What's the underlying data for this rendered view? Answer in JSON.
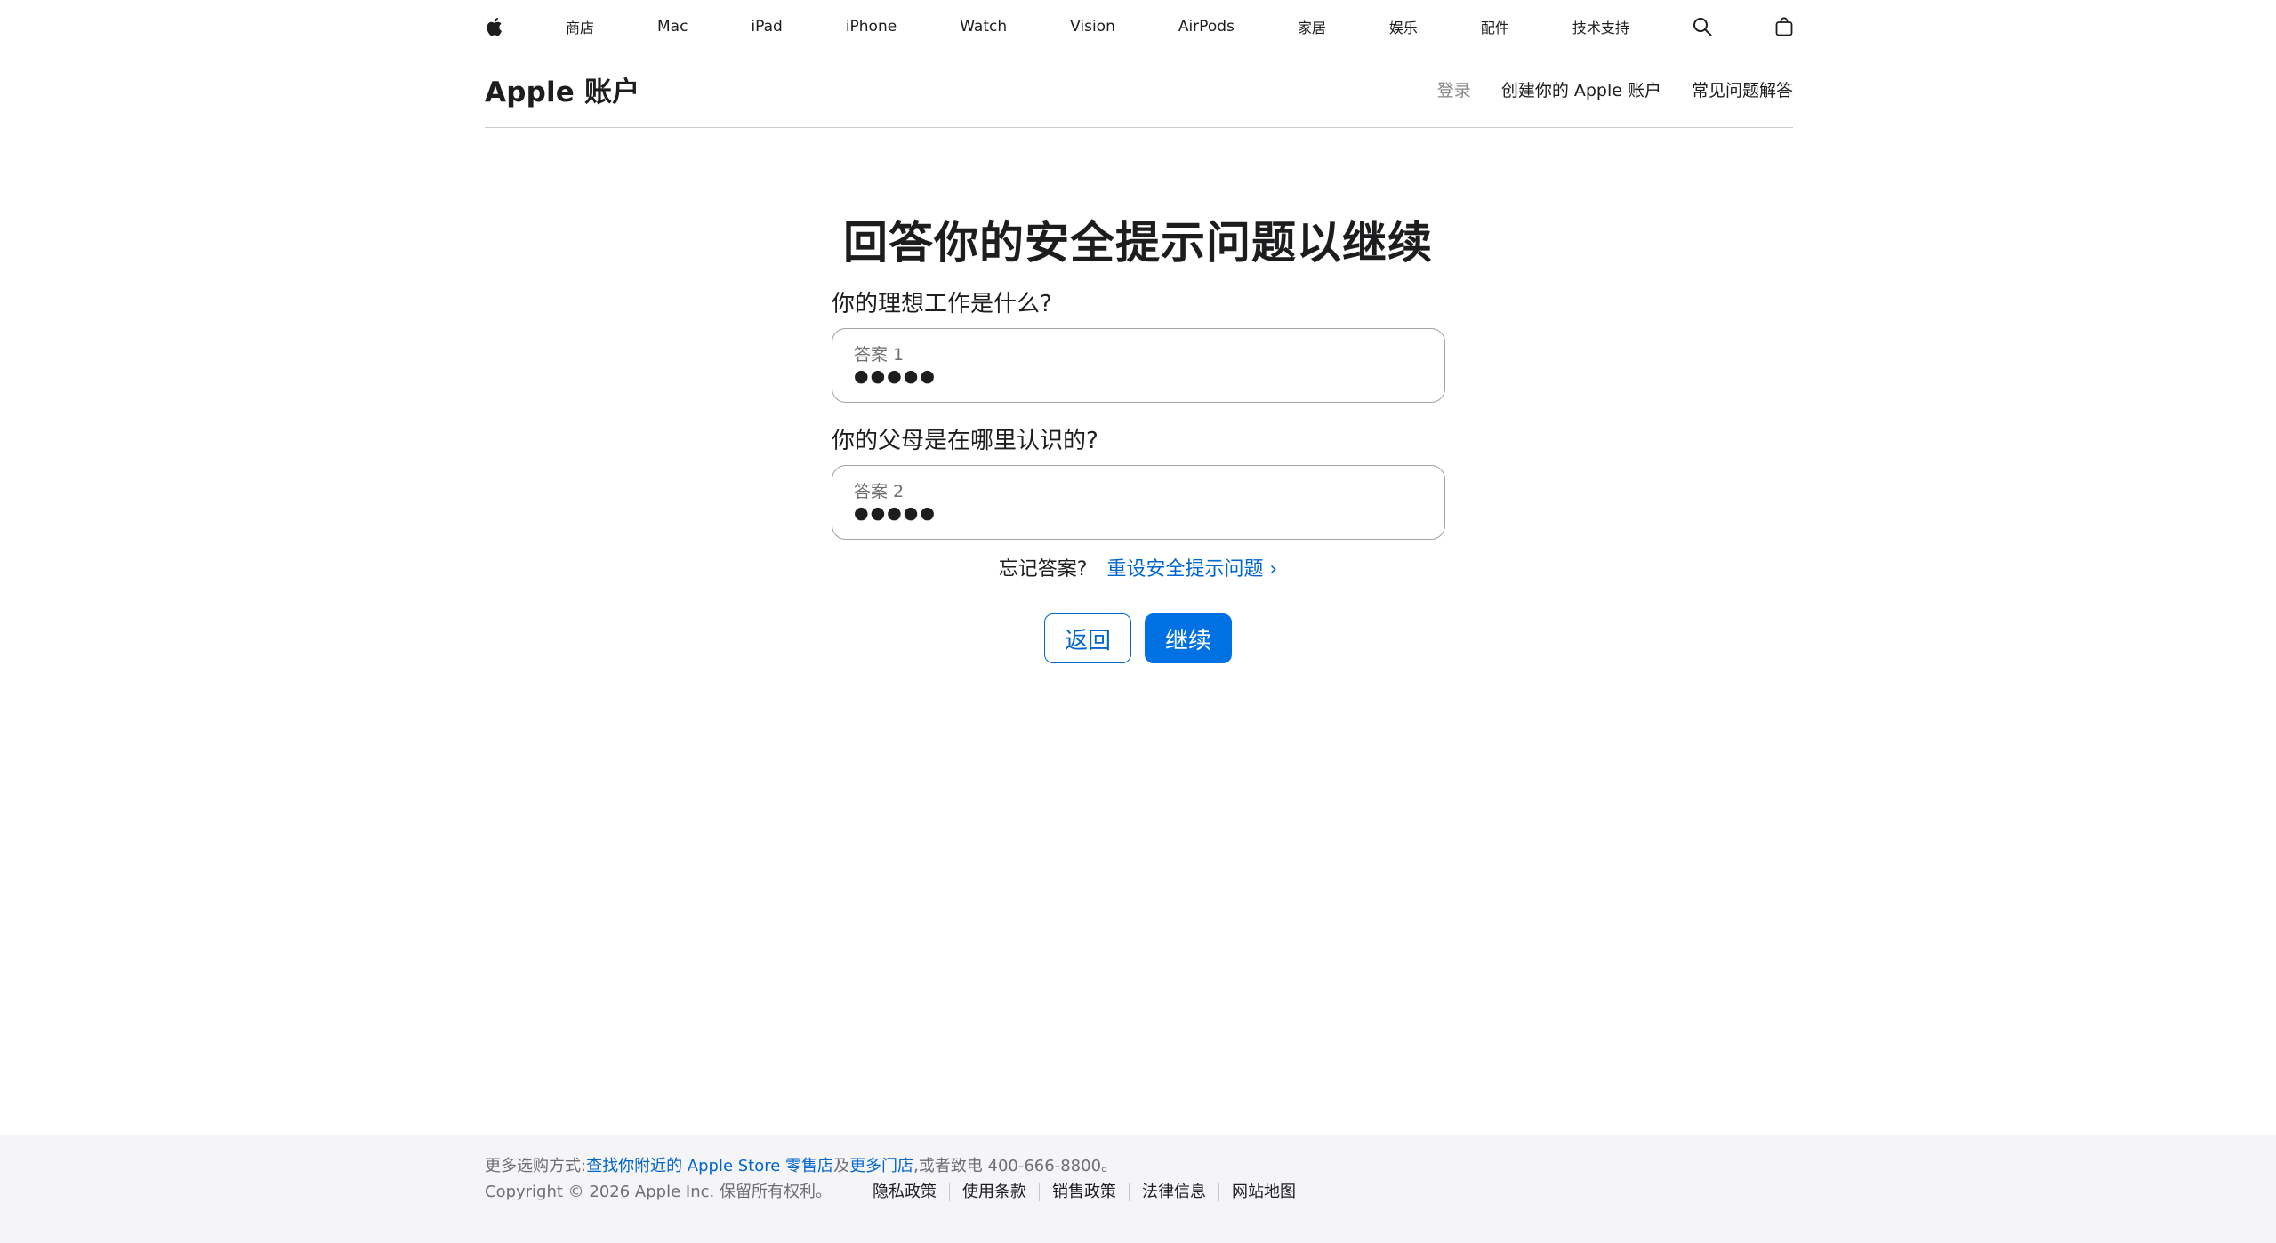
{
  "globalnav": {
    "items": [
      "商店",
      "Mac",
      "iPad",
      "iPhone",
      "Watch",
      "Vision",
      "AirPods",
      "家居",
      "娱乐",
      "配件",
      "技术支持"
    ]
  },
  "localnav": {
    "title": "Apple 账户",
    "links": [
      "登录",
      "创建你的 Apple 账户",
      "常见问题解答"
    ]
  },
  "main": {
    "heading": "回答你的安全提示问题以继续",
    "questions": [
      {
        "text": "你的理想工作是什么?",
        "label": "答案 1",
        "value": "●●●●●"
      },
      {
        "text": "你的父母是在哪里认识的?",
        "label": "答案 2",
        "value": "●●●●●"
      }
    ],
    "forgot_text": "忘记答案?",
    "reset_link": "重设安全提示问题 ›",
    "back_label": "返回",
    "continue_label": "继续"
  },
  "footer": {
    "prefix": "更多选购方式:",
    "store_link": "查找你附近的 Apple Store 零售店",
    "and": "及",
    "more_link": "更多门店",
    "suffix": ",或者致电 400-666-8800。",
    "copyright": "Copyright © 2026 Apple Inc. 保留所有权利。",
    "legal": [
      "隐私政策",
      "使用条款",
      "销售政策",
      "法律信息",
      "网站地图"
    ]
  },
  "colors": {
    "link": "#0066cc",
    "primary_button": "#0071e3",
    "text": "#1d1d1f",
    "footer_bg": "#f5f5f7"
  },
  "icons": [
    "apple-logo-icon",
    "search-icon",
    "shopping-bag-icon"
  ]
}
